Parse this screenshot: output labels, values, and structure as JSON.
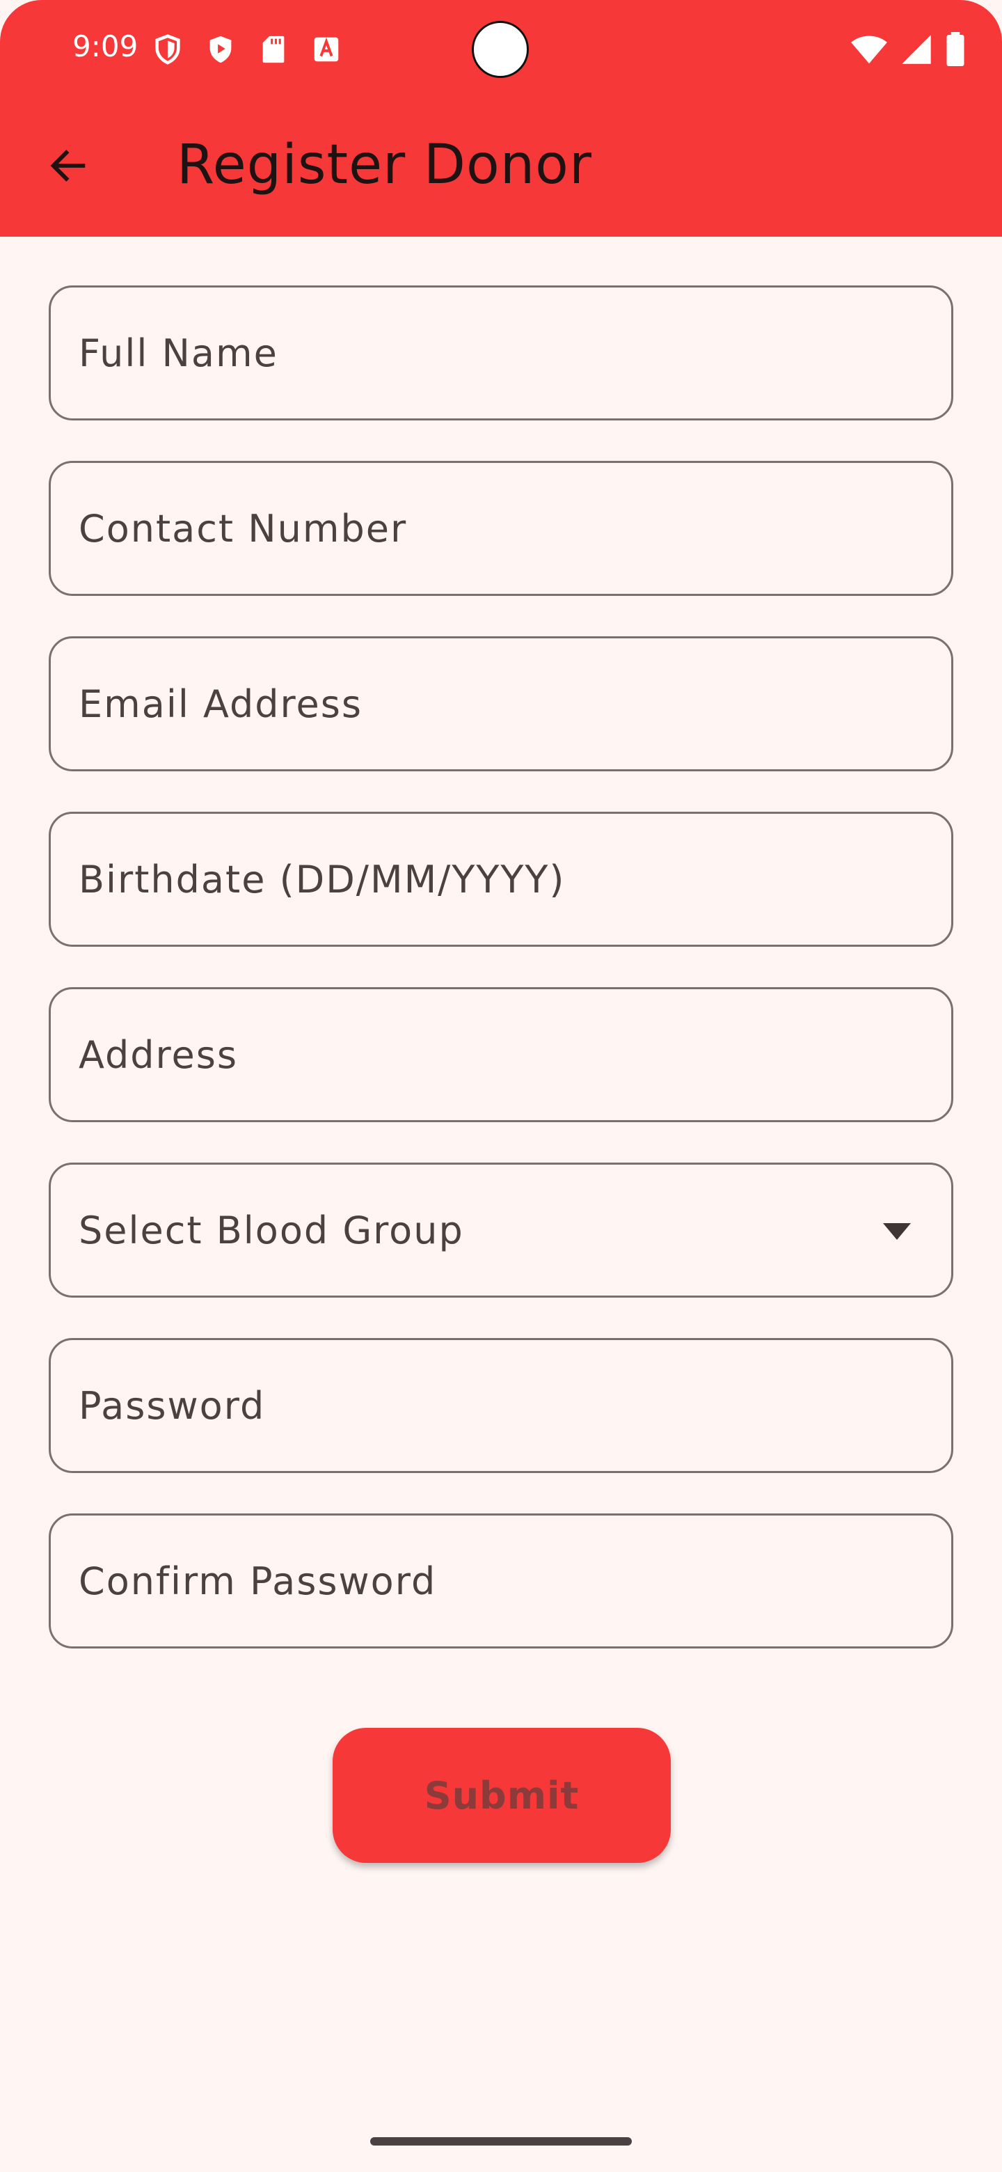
{
  "status_bar": {
    "time": "9:09",
    "left_icons": [
      "shield-icon",
      "play-protect-icon",
      "sd-card-icon",
      "font-a-icon"
    ],
    "right_icons": [
      "wifi-icon",
      "signal-icon",
      "battery-icon"
    ]
  },
  "app_bar": {
    "title": "Register Donor",
    "back_icon": "arrow-left-icon",
    "color": "#f63838"
  },
  "form": {
    "full_name": {
      "placeholder": "Full Name",
      "value": ""
    },
    "contact_number": {
      "placeholder": "Contact Number",
      "value": ""
    },
    "email_address": {
      "placeholder": "Email Address",
      "value": ""
    },
    "birthdate": {
      "placeholder": "Birthdate (DD/MM/YYYY)",
      "value": ""
    },
    "address": {
      "placeholder": "Address",
      "value": ""
    },
    "blood_group": {
      "label": "Select Blood Group"
    },
    "password": {
      "placeholder": "Password",
      "value": ""
    },
    "confirm_password": {
      "placeholder": "Confirm Password",
      "value": ""
    }
  },
  "submit": {
    "label": "Submit",
    "color": "#f63838"
  },
  "colors": {
    "background": "#fff6f4",
    "border": "#7a7070",
    "text": "#4c4040"
  }
}
